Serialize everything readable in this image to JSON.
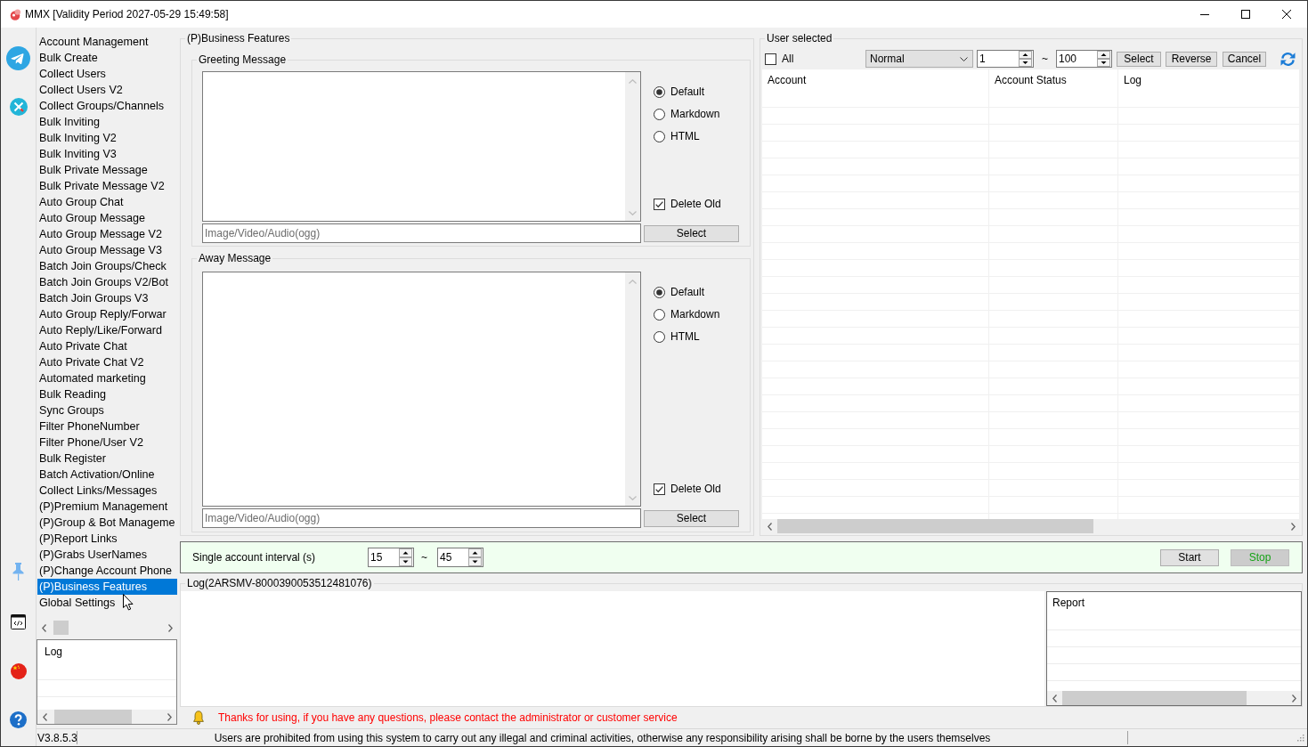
{
  "window": {
    "title": "MMX [Validity Period 2027-05-29 15:49:58]"
  },
  "sidebar": {
    "items": [
      {
        "label": "Account Management",
        "selected": false
      },
      {
        "label": "Bulk Create",
        "selected": false
      },
      {
        "label": "Collect Users",
        "selected": false
      },
      {
        "label": "Collect Users V2",
        "selected": false
      },
      {
        "label": "Collect Groups/Channels",
        "selected": false
      },
      {
        "label": "Bulk Inviting",
        "selected": false
      },
      {
        "label": "Bulk Inviting V2",
        "selected": false
      },
      {
        "label": "Bulk Inviting V3",
        "selected": false
      },
      {
        "label": "Bulk Private Message",
        "selected": false
      },
      {
        "label": "Bulk Private Message V2",
        "selected": false
      },
      {
        "label": "Auto Group Chat",
        "selected": false
      },
      {
        "label": "Auto Group Message",
        "selected": false
      },
      {
        "label": "Auto Group Message V2",
        "selected": false
      },
      {
        "label": "Auto Group Message V3",
        "selected": false
      },
      {
        "label": "Batch Join Groups/Check",
        "selected": false
      },
      {
        "label": "Batch Join Groups V2/Bot",
        "selected": false
      },
      {
        "label": "Batch Join Groups V3",
        "selected": false
      },
      {
        "label": "Auto Group Reply/Forwar",
        "selected": false
      },
      {
        "label": "Auto Reply/Like/Forward",
        "selected": false
      },
      {
        "label": "Auto Private Chat",
        "selected": false
      },
      {
        "label": "Auto Private Chat V2",
        "selected": false
      },
      {
        "label": "Automated marketing",
        "selected": false
      },
      {
        "label": "Bulk Reading",
        "selected": false
      },
      {
        "label": "Sync Groups",
        "selected": false
      },
      {
        "label": "Filter PhoneNumber",
        "selected": false
      },
      {
        "label": "Filter Phone/User V2",
        "selected": false
      },
      {
        "label": "Bulk Register",
        "selected": false
      },
      {
        "label": "Batch Activation/Online",
        "selected": false
      },
      {
        "label": "Collect Links/Messages",
        "selected": false
      },
      {
        "label": "(P)Premium Management",
        "selected": false
      },
      {
        "label": "(P)Group & Bot Manageme",
        "selected": false
      },
      {
        "label": "(P)Report Links",
        "selected": false
      },
      {
        "label": "(P)Grabs UserNames",
        "selected": false
      },
      {
        "label": "(P)Change Account Phone",
        "selected": false
      },
      {
        "label": "(P)Business Features",
        "selected": true
      },
      {
        "label": "Global Settings",
        "selected": false
      }
    ],
    "log_list": {
      "header": "Log"
    }
  },
  "business_features": {
    "title": "(P)Business Features",
    "sections": [
      {
        "title": "Greeting Message",
        "formats": [
          {
            "label": "Default",
            "selected": true
          },
          {
            "label": "Markdown",
            "selected": false
          },
          {
            "label": "HTML",
            "selected": false
          }
        ],
        "delete_old": {
          "label": "Delete Old",
          "checked": true
        },
        "media_field": {
          "placeholder": "Image/Video/Audio(ogg)"
        },
        "select_button": "Select"
      },
      {
        "title": "Away Message",
        "formats": [
          {
            "label": "Default",
            "selected": true
          },
          {
            "label": "Markdown",
            "selected": false
          },
          {
            "label": "HTML",
            "selected": false
          }
        ],
        "delete_old": {
          "label": "Delete Old",
          "checked": true
        },
        "media_field": {
          "placeholder": "Image/Video/Audio(ogg)"
        },
        "select_button": "Select"
      }
    ]
  },
  "user_selected": {
    "title": "User selected",
    "all": {
      "label": "All",
      "checked": false
    },
    "mode": "Normal",
    "range": {
      "from": "1",
      "separator": "~",
      "to": "100"
    },
    "buttons": [
      "Select",
      "Reverse",
      "Cancel"
    ],
    "table": {
      "columns": [
        "Account",
        "Account Status",
        "Log"
      ]
    }
  },
  "interval": {
    "label": "Single account interval (s)",
    "from": "15",
    "separator": "~",
    "to": "45",
    "buttons": [
      {
        "label": "Start",
        "kind": "start"
      },
      {
        "label": "Stop",
        "kind": "stop"
      }
    ]
  },
  "log": {
    "title": "Log(2ARSMV-8000390053512481076)",
    "report": {
      "header": "Report"
    }
  },
  "notice": "Thanks for using, if you have any questions, please contact the administrator or customer service",
  "status_bar": {
    "version": "V3.8.5.3",
    "message": "Users are prohibited from using this system to carry out any illegal and criminal activities, otherwise any responsibility arising shall be borne by the users themselves"
  }
}
